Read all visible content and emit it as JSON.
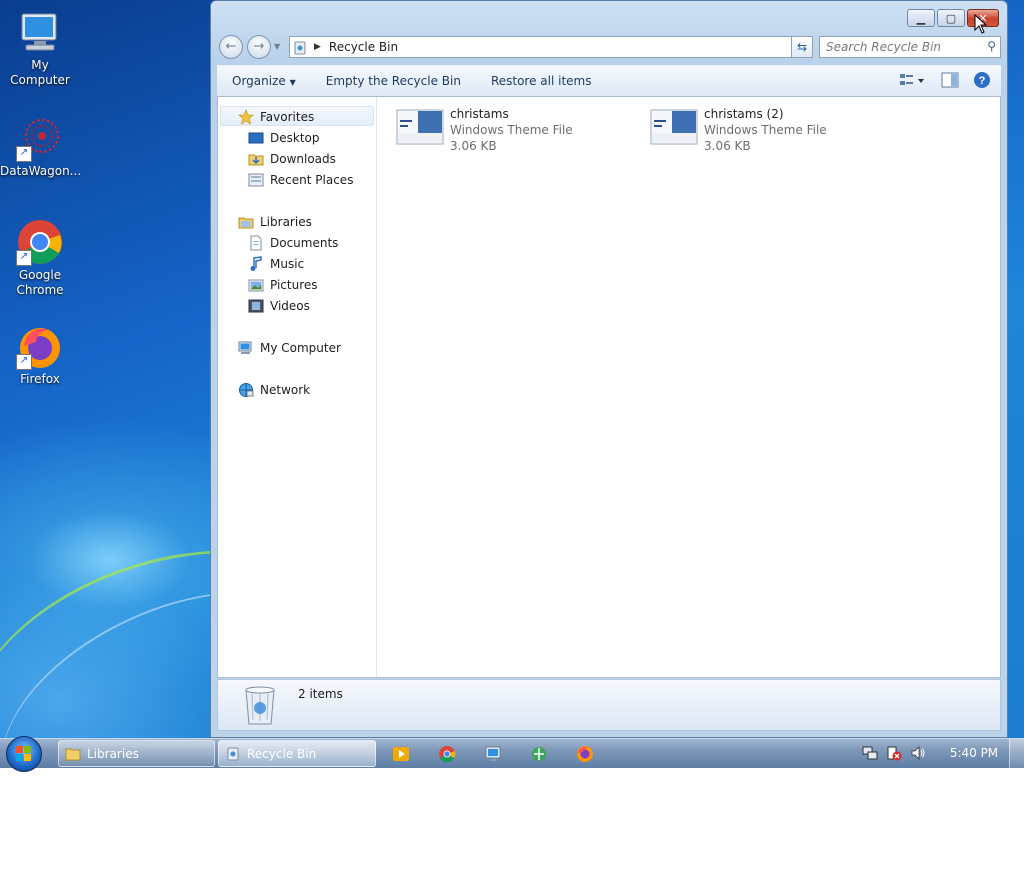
{
  "desktop": {
    "icons": [
      {
        "label": "My Computer",
        "icon": "my-computer-icon"
      },
      {
        "label": "DataWagon...",
        "icon": "datawagon-icon"
      },
      {
        "label": "Google Chrome",
        "icon": "chrome-icon"
      },
      {
        "label": "Firefox",
        "icon": "firefox-icon"
      }
    ]
  },
  "window": {
    "address": {
      "path": "Recycle Bin"
    },
    "search": {
      "placeholder": "Search Recycle Bin"
    },
    "toolbar": {
      "organize": "Organize",
      "empty": "Empty the Recycle Bin",
      "restore": "Restore all items"
    },
    "nav": {
      "favorites": "Favorites",
      "desktop": "Desktop",
      "downloads": "Downloads",
      "recent": "Recent Places",
      "libraries": "Libraries",
      "documents": "Documents",
      "music": "Music",
      "pictures": "Pictures",
      "videos": "Videos",
      "computer": "My Computer",
      "network": "Network"
    },
    "files": [
      {
        "name": "christams",
        "type": "Windows Theme File",
        "size": "3.06 KB"
      },
      {
        "name": "christams (2)",
        "type": "Windows Theme File",
        "size": "3.06 KB"
      }
    ],
    "status": {
      "count": "2 items"
    }
  },
  "taskbar": {
    "items": [
      {
        "label": "Libraries"
      },
      {
        "label": "Recycle Bin"
      }
    ],
    "clock": "5:40 PM"
  },
  "colors": {
    "accent": "#1d6fd1",
    "window_frame": "#bcd3ec",
    "close": "#c7432d"
  }
}
